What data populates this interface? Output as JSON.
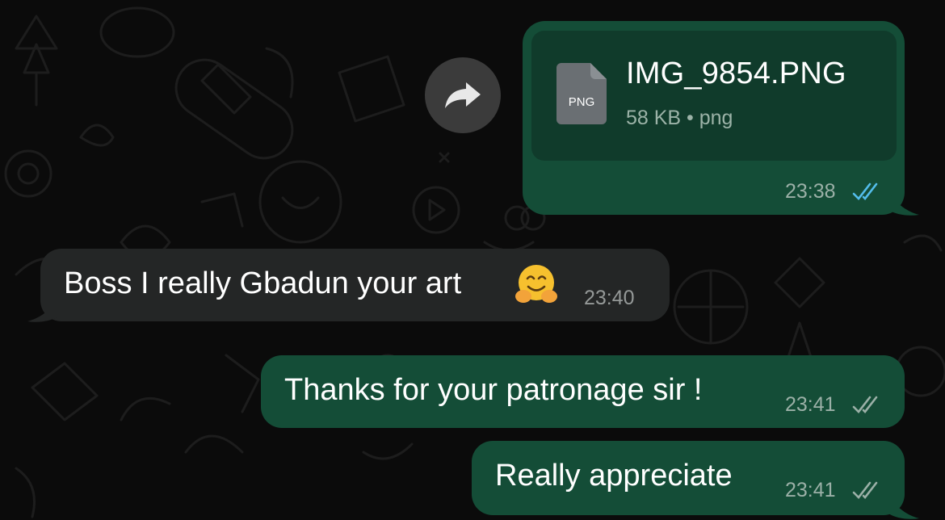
{
  "forward_button": {
    "icon": "forward-arrow-icon"
  },
  "messages": [
    {
      "direction": "outgoing",
      "type": "file",
      "file": {
        "name": "IMG_9854.PNG",
        "badge": "PNG",
        "meta": "58 KB • png"
      },
      "time": "23:38",
      "status": "read",
      "tick_color": "#53bdeb"
    },
    {
      "direction": "incoming",
      "type": "text",
      "text": "Boss I really Gbadun your art",
      "emoji": "hugging-face",
      "time": "23:40"
    },
    {
      "direction": "outgoing",
      "type": "text",
      "text": "Thanks for your patronage sir !",
      "time": "23:41",
      "status": "delivered",
      "tick_color": "#9bb0a7"
    },
    {
      "direction": "outgoing",
      "type": "text",
      "text": "Really appreciate",
      "time": "23:41",
      "status": "delivered",
      "tick_color": "#9bb0a7"
    }
  ],
  "colors": {
    "background": "#0b0b0b",
    "outgoing_bubble": "#144d37",
    "incoming_bubble": "#242626",
    "file_card": "#103b2b"
  }
}
